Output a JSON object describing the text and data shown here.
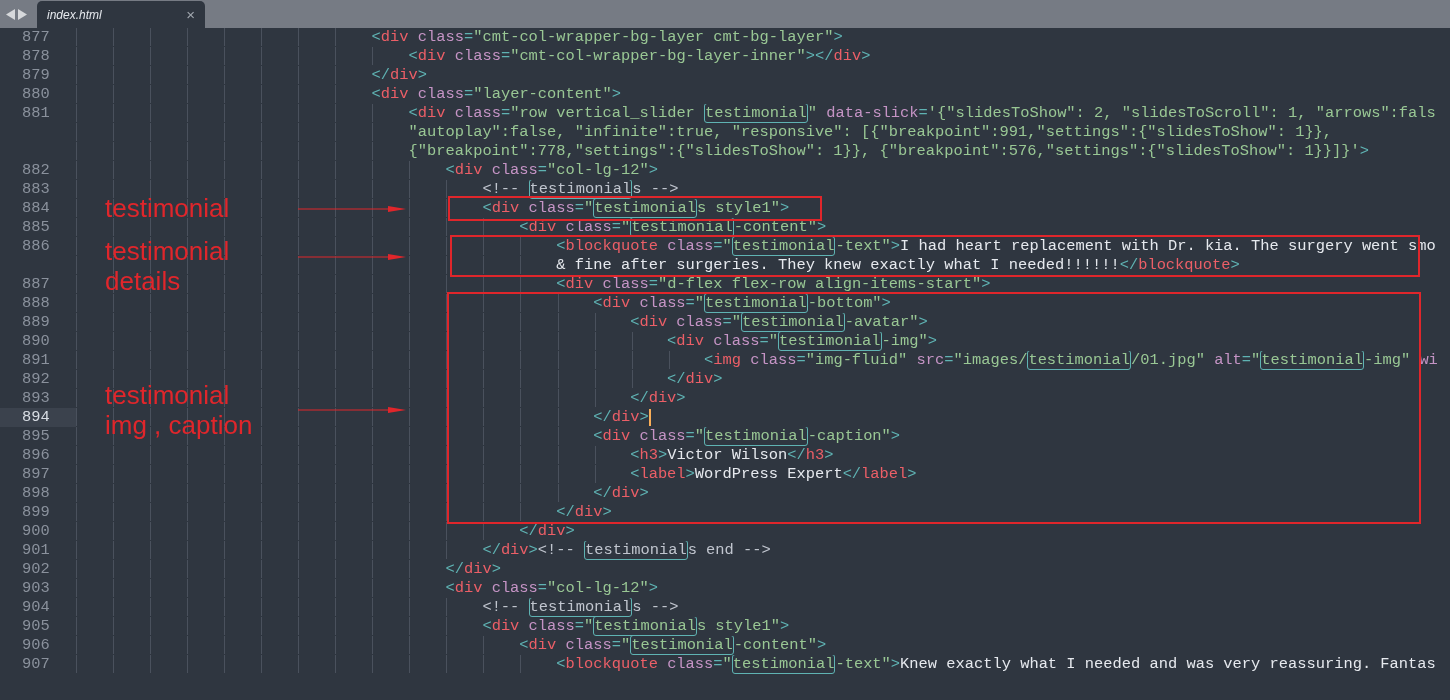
{
  "tabs": [
    {
      "title": "index.html",
      "close": "×",
      "selected": true
    }
  ],
  "lines": [
    {
      "number": "877",
      "current": false,
      "rows": [
        {
          "segments": [
            {
              "kind": "punct",
              "text": "                                <"
            },
            {
              "kind": "tag",
              "text": "div"
            },
            {
              "kind": "attr",
              "text": " class"
            },
            {
              "kind": "punct",
              "text": "="
            },
            {
              "kind": "string",
              "text": "\"cmt-col-wrapper-bg-layer cmt-bg-layer\""
            },
            {
              "kind": "punct",
              "text": ">"
            }
          ]
        }
      ]
    },
    {
      "number": "878",
      "current": false,
      "rows": [
        {
          "segments": [
            {
              "kind": "punct",
              "text": "                                    <"
            },
            {
              "kind": "tag",
              "text": "div"
            },
            {
              "kind": "attr",
              "text": " class"
            },
            {
              "kind": "punct",
              "text": "="
            },
            {
              "kind": "string",
              "text": "\"cmt-col-wrapper-bg-layer-inner\""
            },
            {
              "kind": "punct",
              "text": "></"
            },
            {
              "kind": "tag",
              "text": "div"
            },
            {
              "kind": "punct",
              "text": ">"
            }
          ]
        }
      ]
    },
    {
      "number": "879",
      "current": false,
      "rows": [
        {
          "segments": [
            {
              "kind": "punct",
              "text": "                                </"
            },
            {
              "kind": "tag",
              "text": "div"
            },
            {
              "kind": "punct",
              "text": ">"
            }
          ]
        }
      ]
    },
    {
      "number": "880",
      "current": false,
      "rows": [
        {
          "segments": [
            {
              "kind": "punct",
              "text": "                                <"
            },
            {
              "kind": "tag",
              "text": "div"
            },
            {
              "kind": "attr",
              "text": " class"
            },
            {
              "kind": "punct",
              "text": "="
            },
            {
              "kind": "string",
              "text": "\"layer-content\""
            },
            {
              "kind": "punct",
              "text": ">"
            }
          ]
        }
      ]
    },
    {
      "number": "881",
      "current": false,
      "rows": [
        {
          "segments": [
            {
              "kind": "punct",
              "text": "                                    <"
            },
            {
              "kind": "tag",
              "text": "div"
            },
            {
              "kind": "attr",
              "text": " class"
            },
            {
              "kind": "punct",
              "text": "="
            },
            {
              "kind": "string",
              "text": "\"row vertical_slider "
            },
            {
              "kind": "match",
              "text": "testimonial"
            },
            {
              "kind": "string",
              "text": "\""
            },
            {
              "kind": "attr",
              "text": " data-slick"
            },
            {
              "kind": "punct",
              "text": "="
            },
            {
              "kind": "string",
              "text": "'{\"slidesToShow\": 2, \"slidesToScroll\": 1, \"arrows\":fals"
            }
          ]
        },
        {
          "segments": [
            {
              "kind": "string",
              "text": "                                    \"autoplay\":false, \"infinite\":true, \"responsive\": [{\"breakpoint\":991,\"settings\":{\"slidesToShow\": 1}},"
            }
          ]
        },
        {
          "segments": [
            {
              "kind": "string",
              "text": "                                    {\"breakpoint\":778,\"settings\":{\"slidesToShow\": 1}}, {\"breakpoint\":576,\"settings\":{\"slidesToShow\": 1}}]}'"
            },
            {
              "kind": "punct",
              "text": ">"
            }
          ]
        }
      ]
    },
    {
      "number": "882",
      "current": false,
      "rows": [
        {
          "segments": [
            {
              "kind": "punct",
              "text": "                                        <"
            },
            {
              "kind": "tag",
              "text": "div"
            },
            {
              "kind": "attr",
              "text": " class"
            },
            {
              "kind": "punct",
              "text": "="
            },
            {
              "kind": "string",
              "text": "\"col-lg-12\""
            },
            {
              "kind": "punct",
              "text": ">"
            }
          ]
        }
      ]
    },
    {
      "number": "883",
      "current": false,
      "rows": [
        {
          "segments": [
            {
              "kind": "comment",
              "text": "                                            <!-- "
            },
            {
              "kind": "commentmatch",
              "text": "testimonial"
            },
            {
              "kind": "comment",
              "text": "s -->"
            }
          ]
        }
      ]
    },
    {
      "number": "884",
      "current": false,
      "rows": [
        {
          "segments": [
            {
              "kind": "punct",
              "text": "                                            <"
            },
            {
              "kind": "tag",
              "text": "div"
            },
            {
              "kind": "attr",
              "text": " class"
            },
            {
              "kind": "punct",
              "text": "="
            },
            {
              "kind": "string",
              "text": "\""
            },
            {
              "kind": "match",
              "text": "testimonial"
            },
            {
              "kind": "string",
              "text": "s style1\""
            },
            {
              "kind": "punct",
              "text": ">"
            }
          ]
        }
      ]
    },
    {
      "number": "885",
      "current": false,
      "rows": [
        {
          "segments": [
            {
              "kind": "punct",
              "text": "                                                <"
            },
            {
              "kind": "tag",
              "text": "div"
            },
            {
              "kind": "attr",
              "text": " class"
            },
            {
              "kind": "punct",
              "text": "="
            },
            {
              "kind": "string",
              "text": "\""
            },
            {
              "kind": "match",
              "text": "testimonial"
            },
            {
              "kind": "string",
              "text": "-content\""
            },
            {
              "kind": "punct",
              "text": ">"
            }
          ]
        }
      ]
    },
    {
      "number": "886",
      "current": false,
      "rows": [
        {
          "segments": [
            {
              "kind": "punct",
              "text": "                                                    <"
            },
            {
              "kind": "tag",
              "text": "blockquote"
            },
            {
              "kind": "attr",
              "text": " class"
            },
            {
              "kind": "punct",
              "text": "="
            },
            {
              "kind": "string",
              "text": "\""
            },
            {
              "kind": "match",
              "text": "testimonial"
            },
            {
              "kind": "string",
              "text": "-text\""
            },
            {
              "kind": "punct",
              "text": ">"
            },
            {
              "kind": "text",
              "text": "I had heart replacement with Dr. kia. The surgery went smo"
            }
          ]
        },
        {
          "segments": [
            {
              "kind": "text",
              "text": "                                                    & fine after surgeries. They knew exactly what I needed!!!!!!"
            },
            {
              "kind": "punct",
              "text": "</"
            },
            {
              "kind": "tag",
              "text": "blockquote"
            },
            {
              "kind": "punct",
              "text": ">"
            }
          ]
        }
      ]
    },
    {
      "number": "887",
      "current": false,
      "rows": [
        {
          "segments": [
            {
              "kind": "punct",
              "text": "                                                    <"
            },
            {
              "kind": "tag",
              "text": "div"
            },
            {
              "kind": "attr",
              "text": " class"
            },
            {
              "kind": "punct",
              "text": "="
            },
            {
              "kind": "string",
              "text": "\"d-flex flex-row align-items-start\""
            },
            {
              "kind": "punct",
              "text": ">"
            }
          ]
        }
      ]
    },
    {
      "number": "888",
      "current": false,
      "rows": [
        {
          "segments": [
            {
              "kind": "punct",
              "text": "                                                        <"
            },
            {
              "kind": "tag",
              "text": "div"
            },
            {
              "kind": "attr",
              "text": " class"
            },
            {
              "kind": "punct",
              "text": "="
            },
            {
              "kind": "string",
              "text": "\""
            },
            {
              "kind": "match",
              "text": "testimonial"
            },
            {
              "kind": "string",
              "text": "-bottom\""
            },
            {
              "kind": "punct",
              "text": ">"
            }
          ]
        }
      ]
    },
    {
      "number": "889",
      "current": false,
      "rows": [
        {
          "segments": [
            {
              "kind": "punct",
              "text": "                                                            <"
            },
            {
              "kind": "tag",
              "text": "div"
            },
            {
              "kind": "attr",
              "text": " class"
            },
            {
              "kind": "punct",
              "text": "="
            },
            {
              "kind": "string",
              "text": "\""
            },
            {
              "kind": "match",
              "text": "testimonial"
            },
            {
              "kind": "string",
              "text": "-avatar\""
            },
            {
              "kind": "punct",
              "text": ">"
            }
          ]
        }
      ]
    },
    {
      "number": "890",
      "current": false,
      "rows": [
        {
          "segments": [
            {
              "kind": "punct",
              "text": "                                                                <"
            },
            {
              "kind": "tag",
              "text": "div"
            },
            {
              "kind": "attr",
              "text": " class"
            },
            {
              "kind": "punct",
              "text": "="
            },
            {
              "kind": "string",
              "text": "\""
            },
            {
              "kind": "match",
              "text": "testimonial"
            },
            {
              "kind": "string",
              "text": "-img\""
            },
            {
              "kind": "punct",
              "text": ">"
            }
          ]
        }
      ]
    },
    {
      "number": "891",
      "current": false,
      "rows": [
        {
          "segments": [
            {
              "kind": "punct",
              "text": "                                                                    <"
            },
            {
              "kind": "tag",
              "text": "img"
            },
            {
              "kind": "attr",
              "text": " class"
            },
            {
              "kind": "punct",
              "text": "="
            },
            {
              "kind": "string",
              "text": "\"img-fluid\""
            },
            {
              "kind": "attr",
              "text": " src"
            },
            {
              "kind": "punct",
              "text": "="
            },
            {
              "kind": "string",
              "text": "\"images/"
            },
            {
              "kind": "match",
              "text": "testimonial"
            },
            {
              "kind": "string",
              "text": "/01.jpg\""
            },
            {
              "kind": "attr",
              "text": " alt"
            },
            {
              "kind": "punct",
              "text": "="
            },
            {
              "kind": "string",
              "text": "\""
            },
            {
              "kind": "match",
              "text": "testimonial"
            },
            {
              "kind": "string",
              "text": "-img\""
            },
            {
              "kind": "attr",
              "text": " wi"
            }
          ]
        }
      ]
    },
    {
      "number": "892",
      "current": false,
      "rows": [
        {
          "segments": [
            {
              "kind": "punct",
              "text": "                                                                </"
            },
            {
              "kind": "tag",
              "text": "div"
            },
            {
              "kind": "punct",
              "text": ">"
            }
          ]
        }
      ]
    },
    {
      "number": "893",
      "current": false,
      "rows": [
        {
          "segments": [
            {
              "kind": "punct",
              "text": "                                                            </"
            },
            {
              "kind": "tag",
              "text": "div"
            },
            {
              "kind": "punct",
              "text": ">"
            }
          ]
        }
      ]
    },
    {
      "number": "894",
      "current": true,
      "rows": [
        {
          "segments": [
            {
              "kind": "punct",
              "text": "                                                        </"
            },
            {
              "kind": "tag",
              "text": "div"
            },
            {
              "kind": "punct",
              "text": ">"
            }
          ]
        }
      ]
    },
    {
      "number": "895",
      "current": false,
      "rows": [
        {
          "segments": [
            {
              "kind": "punct",
              "text": "                                                        <"
            },
            {
              "kind": "tag",
              "text": "div"
            },
            {
              "kind": "attr",
              "text": " class"
            },
            {
              "kind": "punct",
              "text": "="
            },
            {
              "kind": "string",
              "text": "\""
            },
            {
              "kind": "match",
              "text": "testimonial"
            },
            {
              "kind": "string",
              "text": "-caption\""
            },
            {
              "kind": "punct",
              "text": ">"
            }
          ]
        }
      ]
    },
    {
      "number": "896",
      "current": false,
      "rows": [
        {
          "segments": [
            {
              "kind": "punct",
              "text": "                                                            <"
            },
            {
              "kind": "tag",
              "text": "h3"
            },
            {
              "kind": "punct",
              "text": ">"
            },
            {
              "kind": "text",
              "text": "Victor Wilson"
            },
            {
              "kind": "punct",
              "text": "</"
            },
            {
              "kind": "tag",
              "text": "h3"
            },
            {
              "kind": "punct",
              "text": ">"
            }
          ]
        }
      ]
    },
    {
      "number": "897",
      "current": false,
      "rows": [
        {
          "segments": [
            {
              "kind": "punct",
              "text": "                                                            <"
            },
            {
              "kind": "tag",
              "text": "label"
            },
            {
              "kind": "punct",
              "text": ">"
            },
            {
              "kind": "text",
              "text": "WordPress Expert"
            },
            {
              "kind": "punct",
              "text": "</"
            },
            {
              "kind": "tag",
              "text": "label"
            },
            {
              "kind": "punct",
              "text": ">"
            }
          ]
        }
      ]
    },
    {
      "number": "898",
      "current": false,
      "rows": [
        {
          "segments": [
            {
              "kind": "punct",
              "text": "                                                        </"
            },
            {
              "kind": "tag",
              "text": "div"
            },
            {
              "kind": "punct",
              "text": ">"
            }
          ]
        }
      ]
    },
    {
      "number": "899",
      "current": false,
      "rows": [
        {
          "segments": [
            {
              "kind": "punct",
              "text": "                                                    </"
            },
            {
              "kind": "tag",
              "text": "div"
            },
            {
              "kind": "punct",
              "text": ">"
            }
          ]
        }
      ]
    },
    {
      "number": "900",
      "current": false,
      "rows": [
        {
          "segments": [
            {
              "kind": "punct",
              "text": "                                                </"
            },
            {
              "kind": "tag",
              "text": "div"
            },
            {
              "kind": "punct",
              "text": ">"
            }
          ]
        }
      ]
    },
    {
      "number": "901",
      "current": false,
      "rows": [
        {
          "segments": [
            {
              "kind": "punct",
              "text": "                                            </"
            },
            {
              "kind": "tag",
              "text": "div"
            },
            {
              "kind": "punct",
              "text": ">"
            },
            {
              "kind": "comment",
              "text": "<!-- "
            },
            {
              "kind": "commentmatch",
              "text": "testimonial"
            },
            {
              "kind": "comment",
              "text": "s end -->"
            }
          ]
        }
      ]
    },
    {
      "number": "902",
      "current": false,
      "rows": [
        {
          "segments": [
            {
              "kind": "punct",
              "text": "                                        </"
            },
            {
              "kind": "tag",
              "text": "div"
            },
            {
              "kind": "punct",
              "text": ">"
            }
          ]
        }
      ]
    },
    {
      "number": "903",
      "current": false,
      "rows": [
        {
          "segments": [
            {
              "kind": "punct",
              "text": "                                        <"
            },
            {
              "kind": "tag",
              "text": "div"
            },
            {
              "kind": "attr",
              "text": " class"
            },
            {
              "kind": "punct",
              "text": "="
            },
            {
              "kind": "string",
              "text": "\"col-lg-12\""
            },
            {
              "kind": "punct",
              "text": ">"
            }
          ]
        }
      ]
    },
    {
      "number": "904",
      "current": false,
      "rows": [
        {
          "segments": [
            {
              "kind": "comment",
              "text": "                                            <!-- "
            },
            {
              "kind": "commentmatch",
              "text": "testimonial"
            },
            {
              "kind": "comment",
              "text": "s -->"
            }
          ]
        }
      ]
    },
    {
      "number": "905",
      "current": false,
      "rows": [
        {
          "segments": [
            {
              "kind": "punct",
              "text": "                                            <"
            },
            {
              "kind": "tag",
              "text": "div"
            },
            {
              "kind": "attr",
              "text": " class"
            },
            {
              "kind": "punct",
              "text": "="
            },
            {
              "kind": "string",
              "text": "\""
            },
            {
              "kind": "match",
              "text": "testimonial"
            },
            {
              "kind": "string",
              "text": "s style1\""
            },
            {
              "kind": "punct",
              "text": ">"
            }
          ]
        }
      ]
    },
    {
      "number": "906",
      "current": false,
      "rows": [
        {
          "segments": [
            {
              "kind": "punct",
              "text": "                                                <"
            },
            {
              "kind": "tag",
              "text": "div"
            },
            {
              "kind": "attr",
              "text": " class"
            },
            {
              "kind": "punct",
              "text": "="
            },
            {
              "kind": "string",
              "text": "\""
            },
            {
              "kind": "match",
              "text": "testimonial"
            },
            {
              "kind": "string",
              "text": "-content\""
            },
            {
              "kind": "punct",
              "text": ">"
            }
          ]
        }
      ]
    },
    {
      "number": "907",
      "current": false,
      "rows": [
        {
          "segments": [
            {
              "kind": "punct",
              "text": "                                                    <"
            },
            {
              "kind": "tag",
              "text": "blockquote"
            },
            {
              "kind": "attr",
              "text": " class"
            },
            {
              "kind": "punct",
              "text": "="
            },
            {
              "kind": "string",
              "text": "\""
            },
            {
              "kind": "match",
              "text": "testimonial"
            },
            {
              "kind": "string",
              "text": "-text\""
            },
            {
              "kind": "punct",
              "text": ">"
            },
            {
              "kind": "text",
              "text": "Knew exactly what I needed and was very reassuring. Fantas"
            }
          ]
        }
      ]
    }
  ],
  "annotations": [
    {
      "text": "testimonial"
    },
    {
      "text": "testimonial\ndetails"
    },
    {
      "text": "testimonial\nimg , caption"
    }
  ]
}
